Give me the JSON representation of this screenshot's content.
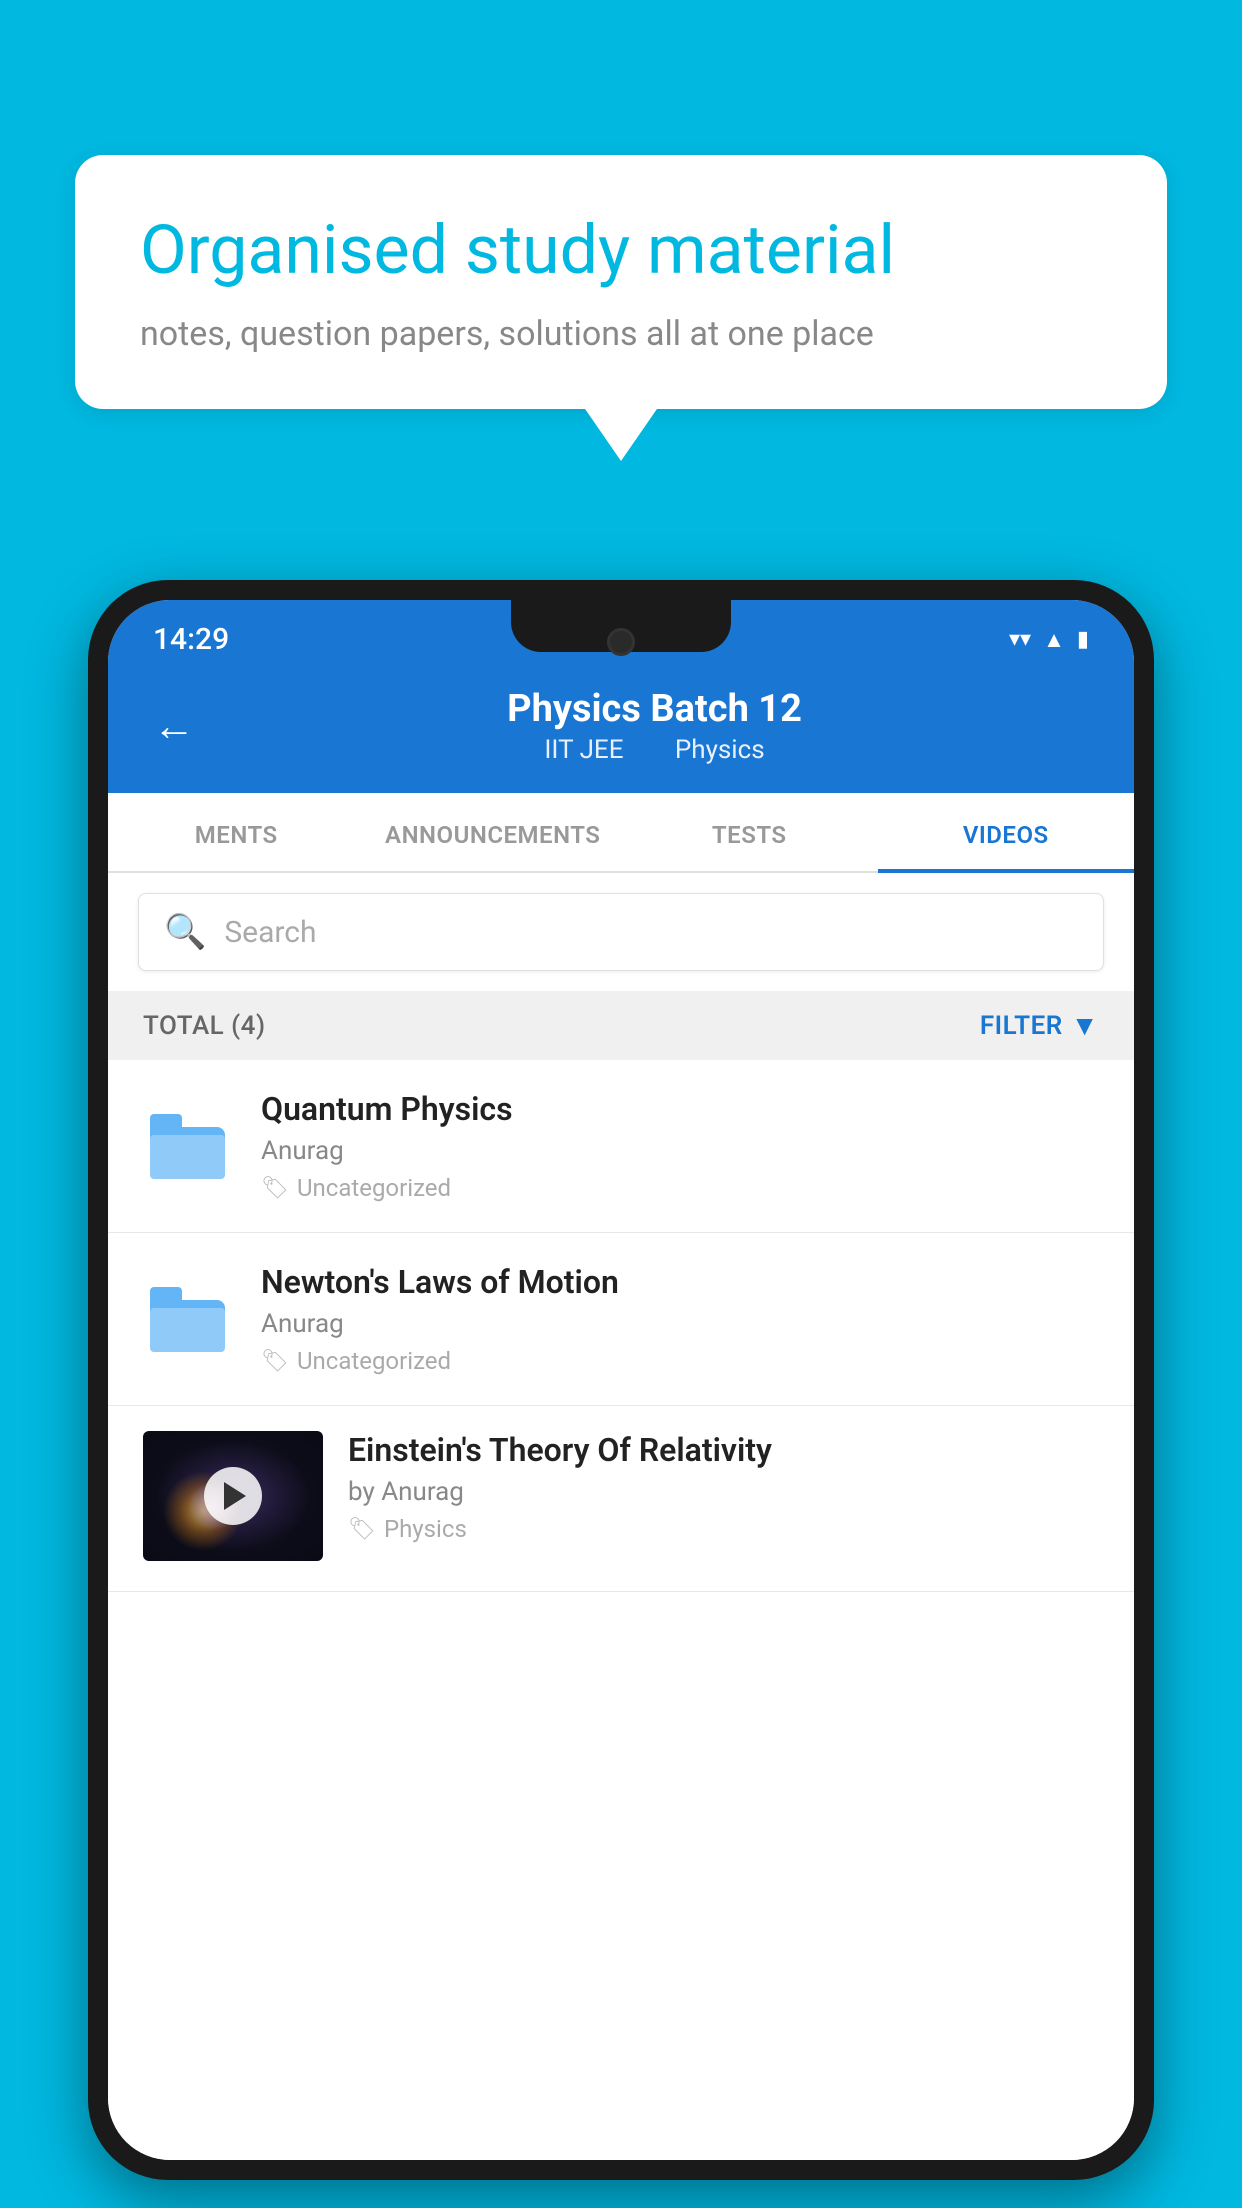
{
  "background_color": "#00B8E0",
  "speech_bubble": {
    "title": "Organised study material",
    "subtitle": "notes, question papers, solutions all at one place"
  },
  "phone": {
    "status_bar": {
      "time": "14:29",
      "icons": [
        "wifi",
        "signal",
        "battery"
      ]
    },
    "app_bar": {
      "back_label": "←",
      "title": "Physics Batch 12",
      "subtitle_parts": [
        "IIT JEE",
        "Physics"
      ]
    },
    "tabs": [
      {
        "label": "MENTS",
        "active": false
      },
      {
        "label": "ANNOUNCEMENTS",
        "active": false
      },
      {
        "label": "TESTS",
        "active": false
      },
      {
        "label": "VIDEOS",
        "active": true
      }
    ],
    "search": {
      "placeholder": "Search"
    },
    "filter": {
      "total_label": "TOTAL (4)",
      "button_label": "FILTER"
    },
    "items": [
      {
        "title": "Quantum Physics",
        "author": "Anurag",
        "tag": "Uncategorized",
        "type": "folder"
      },
      {
        "title": "Newton's Laws of Motion",
        "author": "Anurag",
        "tag": "Uncategorized",
        "type": "folder"
      },
      {
        "title": "Einstein's Theory Of Relativity",
        "author": "by Anurag",
        "tag": "Physics",
        "type": "video"
      }
    ]
  }
}
